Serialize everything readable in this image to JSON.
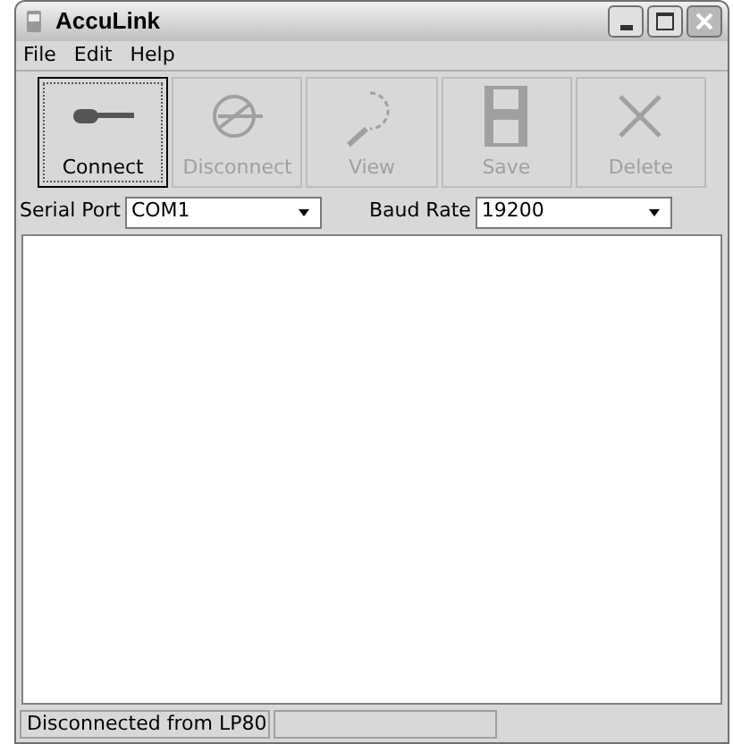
{
  "window": {
    "title": "AccuLink"
  },
  "menu": [
    "File",
    "Edit",
    "Help"
  ],
  "toolbar": [
    {
      "label": "Connect",
      "kind": "connect",
      "disabled": false,
      "selected": true
    },
    {
      "label": "Disconnect",
      "kind": "disconnect",
      "disabled": true,
      "selected": false
    },
    {
      "label": "View",
      "kind": "view",
      "disabled": true,
      "selected": false
    },
    {
      "label": "Save",
      "kind": "save",
      "disabled": true,
      "selected": false
    },
    {
      "label": "Delete",
      "kind": "delete",
      "disabled": true,
      "selected": false
    }
  ],
  "settings": [
    {
      "label": "Serial Port",
      "value": "COM1"
    },
    {
      "label": "Baud Rate",
      "value": "19200"
    }
  ],
  "status_bar": [
    "Disconnected from LP80"
  ]
}
